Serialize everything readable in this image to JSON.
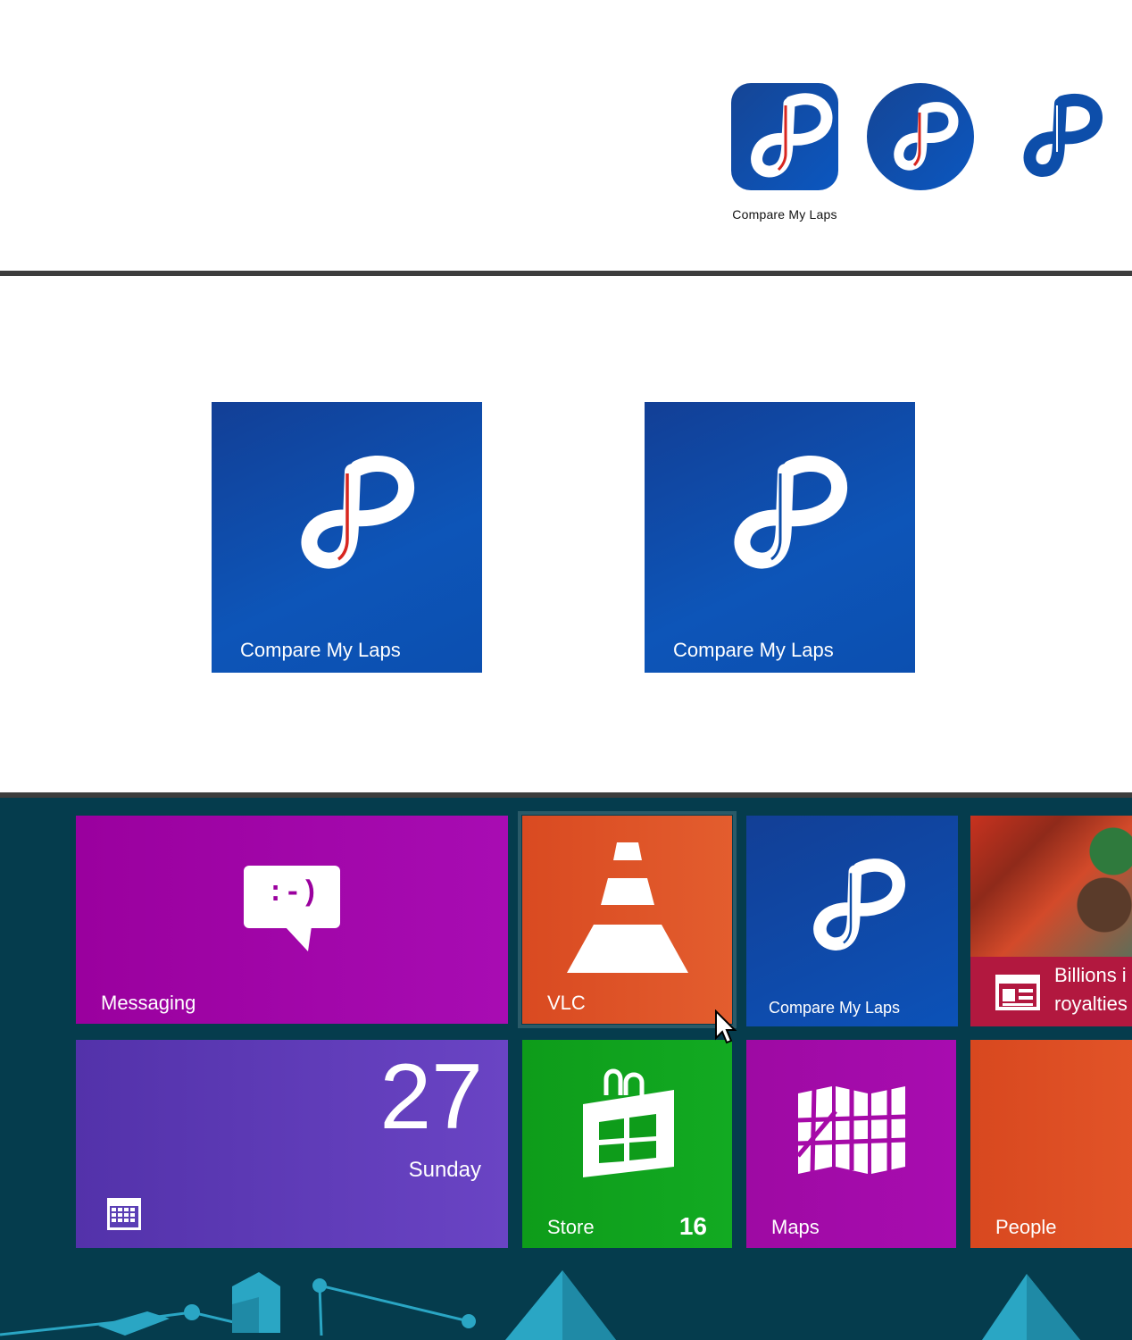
{
  "app": {
    "name": "Compare My Laps",
    "colors": {
      "brand_blue": "#0c4fb0",
      "accent_red": "#d8261f",
      "white": "#ffffff"
    }
  },
  "icon_variants": {
    "caption": "Compare My Laps",
    "items": [
      "rounded-square-icon",
      "circle-icon",
      "glyph-only-icon"
    ]
  },
  "medium_tiles": [
    {
      "label": "Compare My Laps",
      "icon": "logo-icon-with-red-stripe"
    },
    {
      "label": "Compare My Laps",
      "icon": "logo-icon-plain"
    }
  ],
  "start_screen": {
    "tiles": {
      "messaging": {
        "label": "Messaging",
        "icon": "chat-bubble-icon",
        "emoticon": ":-)",
        "color": "#a100ad"
      },
      "vlc": {
        "label": "VLC",
        "icon": "traffic-cone-icon",
        "color": "#e0562a"
      },
      "compare": {
        "label": "Compare My Laps",
        "icon": "logo-icon",
        "color": "#0c4fb0"
      },
      "news": {
        "headline_line1": "Billions i",
        "headline_line2": "royalties",
        "icon": "newspaper-icon",
        "color": "#b2183f"
      },
      "calendar": {
        "day_number": "27",
        "day_name": "Sunday",
        "icon": "calendar-icon",
        "color": "#5b3fb5"
      },
      "store": {
        "label": "Store",
        "badge": "16",
        "icon": "shopping-bag-icon",
        "color": "#10a31d"
      },
      "maps": {
        "label": "Maps",
        "icon": "folded-map-icon",
        "color": "#a60aa8"
      },
      "people": {
        "label": "People",
        "icon": "people-icon",
        "color": "#dc4b22"
      }
    }
  }
}
